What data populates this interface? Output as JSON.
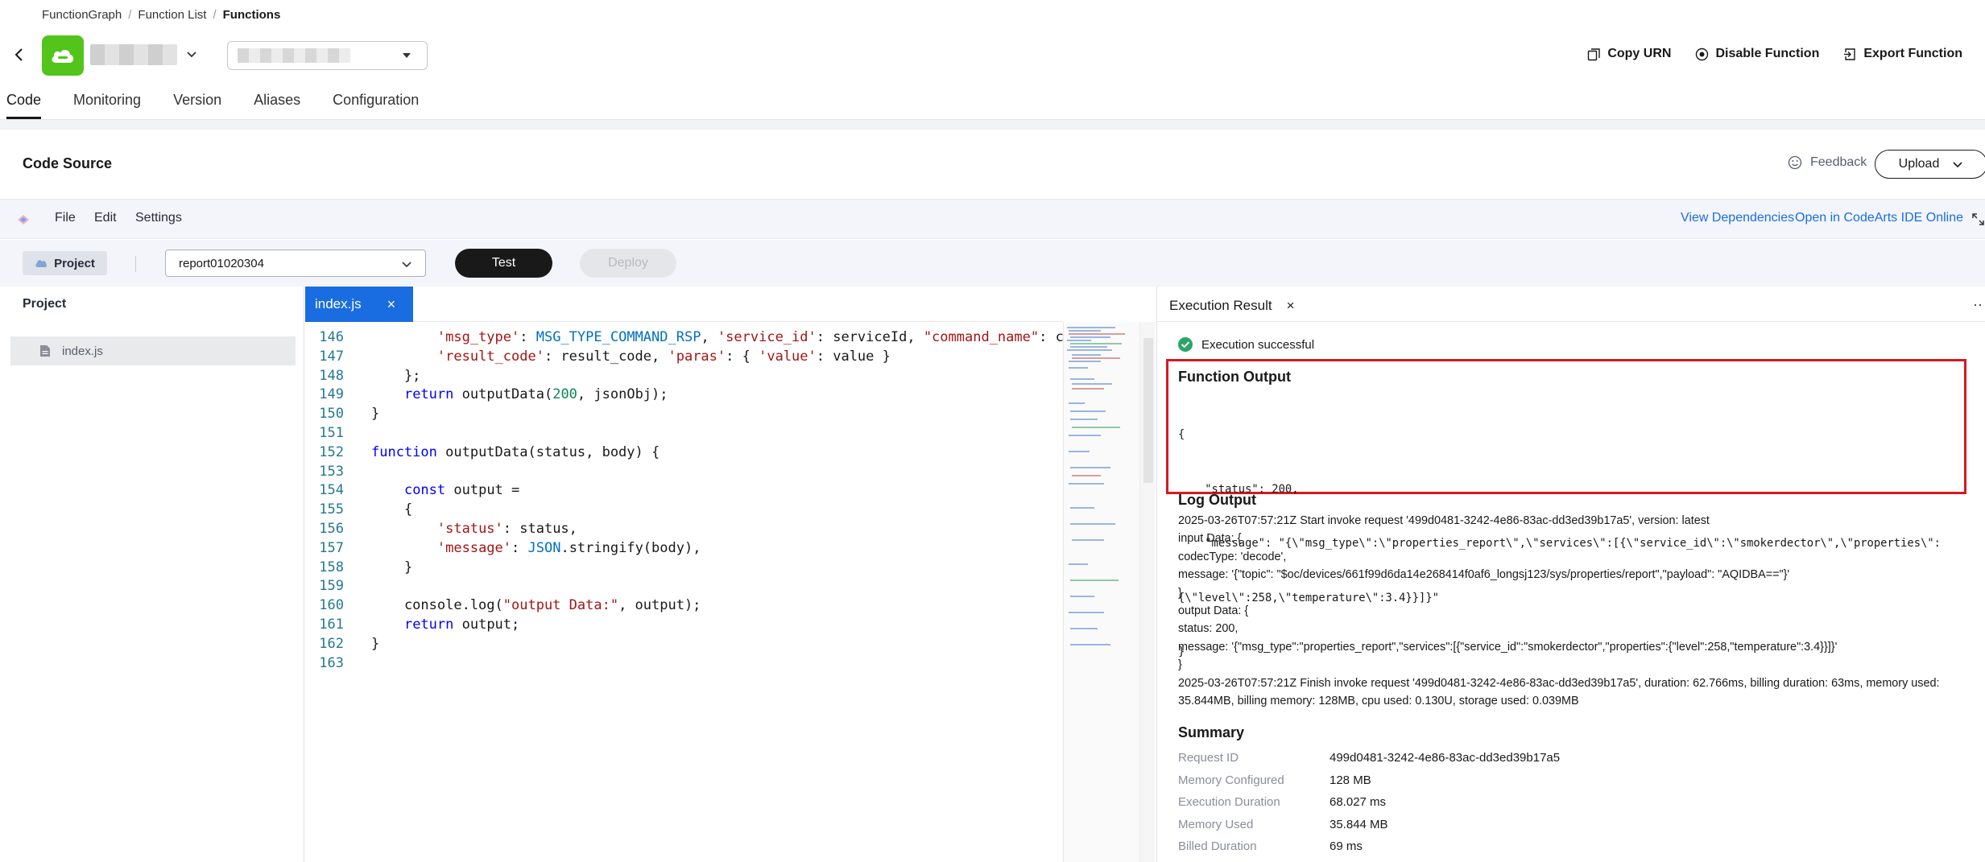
{
  "breadcrumb": {
    "items": [
      "FunctionGraph",
      "Function List",
      "Functions"
    ]
  },
  "header": {
    "actions": {
      "copy_urn": "Copy URN",
      "disable_function": "Disable Function",
      "export_function": "Export Function"
    }
  },
  "tabs": [
    "Code",
    "Monitoring",
    "Version",
    "Aliases",
    "Configuration"
  ],
  "code_source": {
    "title": "Code Source",
    "feedback": "Feedback",
    "upload": "Upload"
  },
  "ide": {
    "menu": [
      "File",
      "Edit",
      "Settings"
    ],
    "links": {
      "view_dependencies": "View Dependencies",
      "open_ide": "Open in CodeArts IDE Online"
    },
    "toolbar": {
      "project": "Project",
      "test_case": "report01020304",
      "test": "Test",
      "deploy": "Deploy"
    },
    "project_panel": {
      "title": "Project",
      "file": "index.js"
    },
    "editor_tab": "index.js",
    "code_lines": [
      {
        "n": "146",
        "html": "        <span class=\"str\">'msg_type'</span>: <span class=\"const\">MSG_TYPE_COMMAND_RSP</span>, <span class=\"str\">'service_id'</span>: serviceId, <span class=\"str\">\"command_name\"</span>: commandName,"
      },
      {
        "n": "147",
        "html": "        <span class=\"str\">'result_code'</span>: result_code, <span class=\"str\">'paras'</span>: { <span class=\"str\">'value'</span>: value }"
      },
      {
        "n": "148",
        "html": "    };"
      },
      {
        "n": "149",
        "html": "    <span class=\"kw\">return</span> outputData(<span class=\"num\">200</span>, jsonObj);"
      },
      {
        "n": "150",
        "html": "}"
      },
      {
        "n": "151",
        "html": ""
      },
      {
        "n": "152",
        "html": "<span class=\"kw\">function</span> outputData(status, body) {"
      },
      {
        "n": "153",
        "html": ""
      },
      {
        "n": "154",
        "html": "    <span class=\"kw\">const</span> output ="
      },
      {
        "n": "155",
        "html": "    {"
      },
      {
        "n": "156",
        "html": "        <span class=\"str\">'status'</span>: status,"
      },
      {
        "n": "157",
        "html": "        <span class=\"str\">'message'</span>: <span class=\"const\">JSON</span>.stringify(body),"
      },
      {
        "n": "158",
        "html": "    }"
      },
      {
        "n": "159",
        "html": ""
      },
      {
        "n": "160",
        "html": "    console.log(<span class=\"str\">\"output Data:\"</span>, output);"
      },
      {
        "n": "161",
        "html": "    <span class=\"kw\">return</span> output;"
      },
      {
        "n": "162",
        "html": "}"
      },
      {
        "n": "163",
        "html": ""
      }
    ]
  },
  "execution": {
    "tab_title": "Execution Result",
    "status": "Execution successful",
    "function_output_title": "Function Output",
    "function_output_lines": [
      "{",
      "    \"status\": 200,",
      "    \"message\": \"{\\\"msg_type\\\":\\\"properties_report\\\",\\\"services\\\":[{\\\"service_id\\\":\\\"smokerdector\\\",\\\"properties\\\":",
      "{\\\"level\\\":258,\\\"temperature\\\":3.4}}]}\"",
      "}"
    ],
    "log_title": "Log Output",
    "log_lines": [
      "2025-03-26T07:57:21Z Start invoke request '499d0481-3242-4e86-83ac-dd3ed39b17a5', version: latest",
      "input Data: {",
      "codecType: 'decode',",
      "message: '{\"topic\": \"$oc/devices/661f99d6da14e268414f0af6_longsj123/sys/properties/report\",\"payload\": \"AQIDBA==\"}'",
      "}",
      "output Data: {",
      "status: 200,",
      "message: '{\"msg_type\":\"properties_report\",\"services\":[{\"service_id\":\"smokerdector\",\"properties\":{\"level\":258,\"temperature\":3.4}}]}'",
      "}",
      "2025-03-26T07:57:21Z Finish invoke request '499d0481-3242-4e86-83ac-dd3ed39b17a5', duration: 62.766ms, billing duration: 63ms, memory used:",
      "35.844MB, billing memory: 128MB, cpu used: 0.130U, storage used: 0.039MB"
    ],
    "summary_title": "Summary",
    "summary": [
      {
        "k": "Request ID",
        "v": "499d0481-3242-4e86-83ac-dd3ed39b17a5"
      },
      {
        "k": "Memory Configured",
        "v": "128 MB"
      },
      {
        "k": "Execution Duration",
        "v": "68.027 ms"
      },
      {
        "k": "Memory Used",
        "v": "35.844 MB"
      },
      {
        "k": "Billed Duration",
        "v": "69 ms"
      }
    ]
  },
  "colors": {
    "accent": "#1a6de0",
    "success": "#2ca46a",
    "highlight_border": "#d71920",
    "logo_green": "#52c41a"
  },
  "icons": {
    "back": "back-arrow-icon",
    "logo": "function-logo-icon",
    "copy": "copy-icon",
    "disable": "disable-icon",
    "export": "export-icon",
    "feedback": "smile-icon",
    "success": "check-circle-icon",
    "file": "file-icon",
    "close": "close-icon",
    "expand": "expand-icon",
    "more": "more-icon"
  }
}
